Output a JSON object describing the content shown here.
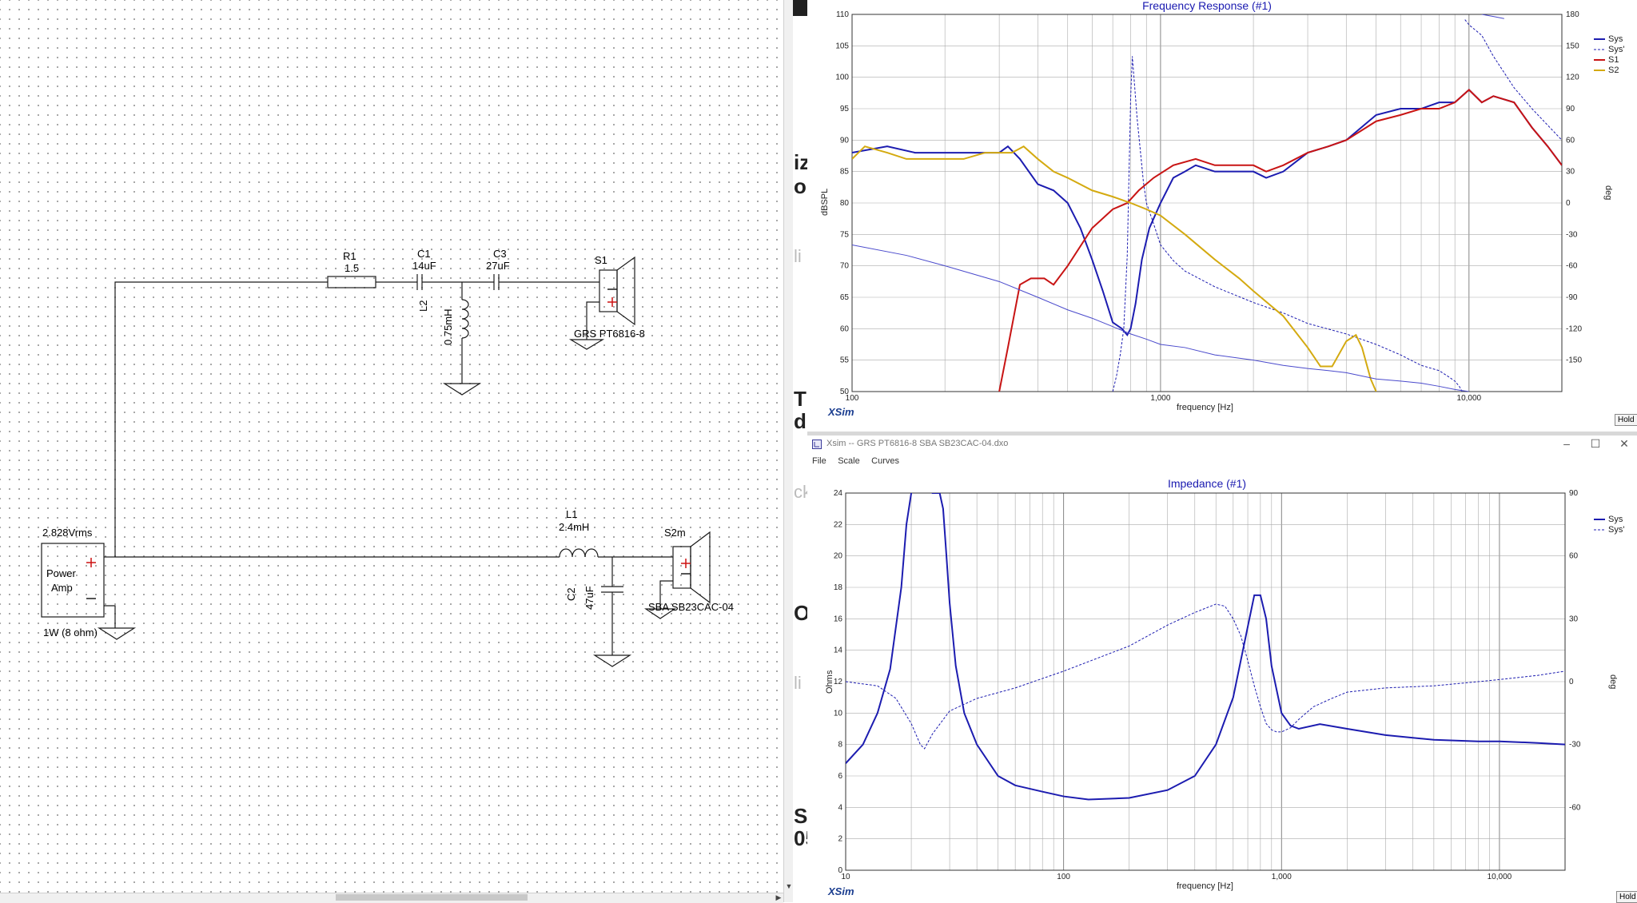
{
  "schematic": {
    "source": {
      "voltage": "2.828Vrms",
      "name_line1": "Power",
      "name_line2": "Amp",
      "power": "1W (8 ohm)"
    },
    "r1": {
      "name": "R1",
      "value": "1.5"
    },
    "c1": {
      "name": "C1",
      "value": "14uF"
    },
    "c3": {
      "name": "C3",
      "value": "27uF"
    },
    "l2": {
      "name": "L2",
      "value": "0.75mH"
    },
    "s1": {
      "name": "S1",
      "model": "GRS PT6816-8"
    },
    "l1": {
      "name": "L1",
      "value": "2.4mH"
    },
    "c2": {
      "name": "C2",
      "value": "47uF"
    },
    "s2": {
      "name": "S2m",
      "model": "SBA SB23CAC-04"
    }
  },
  "background_fragments": [
    "iz",
    "o",
    "li",
    "T",
    "dr",
    "ck",
    "O",
    "li",
    "Si",
    "05"
  ],
  "freq_window": {
    "brand": "XSim",
    "hold_label": "Hold"
  },
  "imp_window": {
    "title": "Xsim -- GRS PT6816-8 SBA SB23CAC-04.dxo",
    "menu": [
      "File",
      "Scale",
      "Curves"
    ],
    "brand": "XSim",
    "hold_label": "Hold"
  },
  "chart_data": [
    {
      "type": "line",
      "title": "Frequency Response (#1)",
      "xlabel": "frequency [Hz]",
      "ylabel": "dBSPL",
      "y2label": "deg",
      "xscale": "log",
      "xlim": [
        100,
        20000
      ],
      "ylim": [
        50,
        110
      ],
      "y2lim": [
        -180,
        180
      ],
      "xticks": [
        {
          "v": 100,
          "label": "100"
        },
        {
          "v": 1000,
          "label": "1,000"
        },
        {
          "v": 10000,
          "label": "10,000"
        }
      ],
      "yticks": [
        50,
        55,
        60,
        65,
        70,
        75,
        80,
        85,
        90,
        95,
        100,
        105,
        110
      ],
      "y2ticks": [
        -150,
        -120,
        -90,
        -60,
        -30,
        0,
        30,
        60,
        90,
        120,
        150,
        180
      ],
      "legend_position": "top-right",
      "series": [
        {
          "name": "Sys",
          "axis": "left",
          "color": "#1c1cb0",
          "width": 2,
          "dash": "",
          "x": [
            100,
            130,
            160,
            200,
            250,
            300,
            320,
            350,
            400,
            450,
            500,
            550,
            600,
            650,
            700,
            750,
            780,
            800,
            830,
            870,
            920,
            1000,
            1100,
            1200,
            1300,
            1500,
            1800,
            2000,
            2200,
            2500,
            3000,
            3500,
            4000,
            5000,
            6000,
            7000,
            8000,
            9000,
            10000,
            11000,
            12000,
            14000,
            16000,
            18000,
            20000
          ],
          "y": [
            88,
            89,
            88,
            88,
            88,
            88,
            89,
            87,
            83,
            82,
            80,
            76,
            71,
            66,
            61,
            60,
            59,
            60,
            64,
            71,
            76,
            80,
            84,
            85,
            86,
            85,
            85,
            85,
            84,
            85,
            88,
            89,
            90,
            94,
            95,
            95,
            96,
            96,
            98,
            96,
            97,
            96,
            92,
            89,
            86
          ]
        },
        {
          "name": "Sys'",
          "axis": "right",
          "color": "#1c1cb0",
          "width": 1,
          "dash": "3,2",
          "x": [
            700,
            720,
            740,
            760,
            780,
            800,
            810,
            820,
            840,
            860,
            880,
            900,
            950,
            1000,
            1100,
            1200,
            1500,
            2000,
            2500,
            3000,
            4000,
            5000,
            6000,
            7000,
            8000,
            8500,
            9000,
            9300,
            9500,
            9700,
            10000,
            11000,
            12000,
            14000,
            16000,
            20000
          ],
          "y": [
            -180,
            -165,
            -145,
            -120,
            -50,
            100,
            140,
            120,
            80,
            50,
            20,
            0,
            -20,
            -40,
            -55,
            -65,
            -80,
            -95,
            -105,
            -115,
            -125,
            -135,
            -145,
            -155,
            -160,
            -165,
            -170,
            -175,
            -180,
            175,
            170,
            160,
            140,
            110,
            90,
            60
          ]
        },
        {
          "name": "S1",
          "axis": "left",
          "color": "#c81414",
          "width": 2,
          "dash": "",
          "x": [
            300,
            320,
            350,
            380,
            420,
            450,
            500,
            600,
            700,
            780,
            850,
            950,
            1100,
            1300,
            1500,
            1800,
            2000,
            2200,
            2500,
            3000,
            3500,
            4000,
            5000,
            6000,
            7000,
            8000,
            9000,
            10000,
            11000,
            12000,
            14000,
            16000,
            18000,
            20000
          ],
          "y": [
            50,
            57,
            67,
            68,
            68,
            67,
            70,
            76,
            79,
            80,
            82,
            84,
            86,
            87,
            86,
            86,
            86,
            85,
            86,
            88,
            89,
            90,
            93,
            94,
            95,
            95,
            96,
            98,
            96,
            97,
            96,
            92,
            89,
            86
          ]
        },
        {
          "name": "S2",
          "axis": "left",
          "color": "#d4aa10",
          "width": 2,
          "dash": "",
          "x": [
            100,
            110,
            130,
            150,
            170,
            200,
            230,
            270,
            300,
            330,
            360,
            400,
            450,
            500,
            600,
            700,
            800,
            900,
            1000,
            1200,
            1500,
            1800,
            2000,
            2500,
            3000,
            3300,
            3600,
            4000,
            4300,
            4500,
            4800,
            5000
          ],
          "y": [
            87,
            89,
            88,
            87,
            87,
            87,
            87,
            88,
            88,
            88,
            89,
            87,
            85,
            84,
            82,
            81,
            80,
            79,
            78,
            75,
            71,
            68,
            66,
            62,
            57,
            54,
            54,
            58,
            59,
            57,
            52,
            50
          ]
        },
        {
          "name": "",
          "axis": "right",
          "color": "#4a4acc",
          "width": 1,
          "dash": "",
          "x": [
            100,
            150,
            200,
            300,
            400,
            500,
            600,
            700,
            800,
            900,
            1000,
            1200,
            1500,
            2000,
            2500,
            3000,
            3500,
            4000,
            5000,
            6000,
            7000,
            8000,
            9000,
            10000,
            11000,
            12000,
            13000
          ],
          "y": [
            -40,
            -50,
            -60,
            -75,
            -90,
            -102,
            -110,
            -118,
            -125,
            -130,
            -135,
            -138,
            -145,
            -150,
            -155,
            -158,
            -160,
            -162,
            -168,
            -170,
            -172,
            -175,
            -178,
            -180,
            180,
            178,
            176
          ]
        }
      ]
    },
    {
      "type": "line",
      "title": "Impedance (#1)",
      "xlabel": "frequency [Hz]",
      "ylabel": "Ohms",
      "y2label": "deg",
      "xscale": "log",
      "xlim": [
        10,
        20000
      ],
      "ylim": [
        0,
        24
      ],
      "y2lim": [
        -90,
        90
      ],
      "xticks": [
        {
          "v": 10,
          "label": "10"
        },
        {
          "v": 100,
          "label": "100"
        },
        {
          "v": 1000,
          "label": "1,000"
        },
        {
          "v": 10000,
          "label": "10,000"
        }
      ],
      "yticks": [
        0,
        2,
        4,
        6,
        8,
        10,
        12,
        14,
        16,
        18,
        20,
        22,
        24
      ],
      "y2ticks": [
        -60,
        -30,
        0,
        30,
        60,
        90
      ],
      "legend_position": "top-right",
      "series": [
        {
          "name": "Sys",
          "axis": "left",
          "color": "#1c1cb0",
          "width": 2,
          "dash": "",
          "x": [
            10,
            12,
            14,
            16,
            18,
            19,
            20,
            21,
            22,
            23,
            25,
            27,
            28,
            29,
            30,
            32,
            35,
            40,
            50,
            60,
            80,
            100,
            130,
            200,
            300,
            400,
            500,
            600,
            700,
            750,
            800,
            850,
            900,
            1000,
            1100,
            1200,
            1500,
            2000,
            3000,
            5000,
            8000,
            10000,
            15000,
            20000
          ],
          "y": [
            6.8,
            8,
            10,
            12.8,
            18,
            22,
            24,
            25,
            26,
            25,
            24,
            24,
            23,
            20,
            17,
            13,
            10,
            8,
            6,
            5.4,
            5,
            4.7,
            4.5,
            4.6,
            5.1,
            6,
            8,
            11,
            15.5,
            17.5,
            17.5,
            16,
            13,
            10,
            9.2,
            9,
            9.3,
            9,
            8.6,
            8.3,
            8.2,
            8.2,
            8.1,
            8.0
          ]
        },
        {
          "name": "Sys'",
          "axis": "right",
          "color": "#1c1cb0",
          "width": 1,
          "dash": "3,2",
          "x": [
            10,
            14,
            17,
            20,
            22,
            23,
            25,
            30,
            40,
            60,
            100,
            200,
            300,
            400,
            500,
            550,
            600,
            650,
            700,
            750,
            800,
            850,
            900,
            950,
            1000,
            1100,
            1200,
            1400,
            1700,
            2000,
            3000,
            5000,
            8000,
            10000,
            15000,
            20000
          ],
          "y": [
            0,
            -2,
            -8,
            -20,
            -30,
            -32,
            -25,
            -14,
            -8,
            -3,
            5,
            17,
            27,
            33,
            37,
            36,
            30,
            22,
            10,
            -2,
            -12,
            -20,
            -23,
            -24,
            -24,
            -22,
            -18,
            -12,
            -8,
            -5,
            -3,
            -2,
            0,
            1,
            3,
            5
          ]
        }
      ]
    }
  ]
}
